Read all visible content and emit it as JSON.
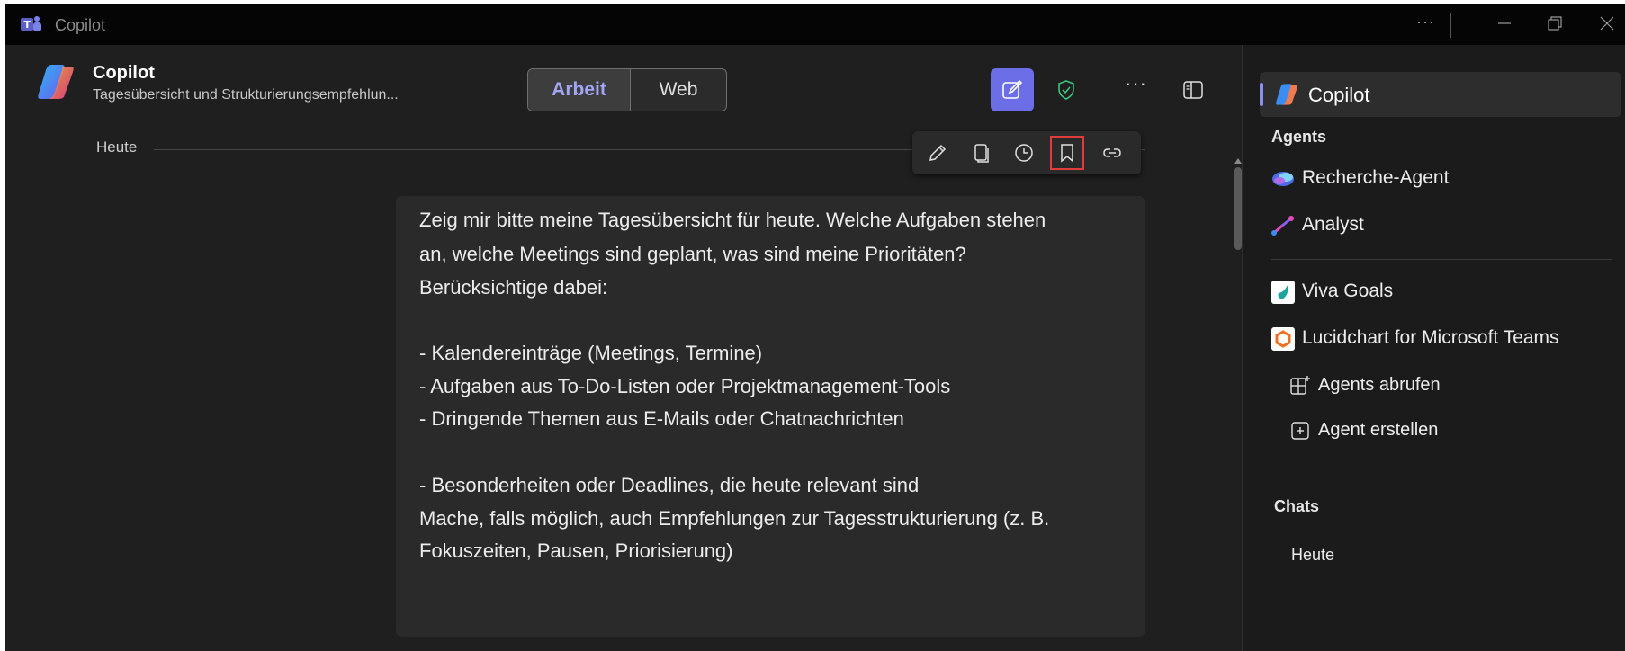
{
  "window": {
    "title": "Copilot",
    "more": "···"
  },
  "header": {
    "title": "Copilot",
    "subtitle": "Tagesübersicht und Strukturierungsempfehlun...",
    "toggle": {
      "active": "Arbeit",
      "inactive": "Web"
    },
    "more": "···"
  },
  "chat": {
    "date_label": "Heute",
    "message_lines": [
      "Zeig mir bitte meine Tagesübersicht für heute. Welche Aufgaben stehen",
      "an, welche Meetings sind geplant, was sind meine Prioritäten?",
      "Berücksichtige dabei:",
      "- Kalendereinträge (Meetings, Termine)",
      "- Aufgaben aus To-Do-Listen oder Projektmanagement-Tools",
      "- Dringende Themen aus E-Mails oder Chatnachrichten",
      "- Besonderheiten oder Deadlines, die heute relevant sind",
      "Mache, falls möglich, auch Empfehlungen zur Tagesstrukturierung (z. B.",
      "Fokuszeiten, Pausen, Priorisierung)"
    ]
  },
  "sidebar": {
    "selected": "Copilot",
    "agents_heading": "Agents",
    "agents": [
      "Recherche-Agent",
      "Analyst"
    ],
    "apps": [
      "Viva Goals",
      "Lucidchart for Microsoft Teams"
    ],
    "actions": [
      "Agents abrufen",
      "Agent erstellen"
    ],
    "chats_heading": "Chats",
    "chats_group": "Heute"
  },
  "colors": {
    "accent": "#6b6ee6",
    "accent_text": "#a2a6f5",
    "highlight": "#e03c3c",
    "background": "#1f1f1f"
  }
}
